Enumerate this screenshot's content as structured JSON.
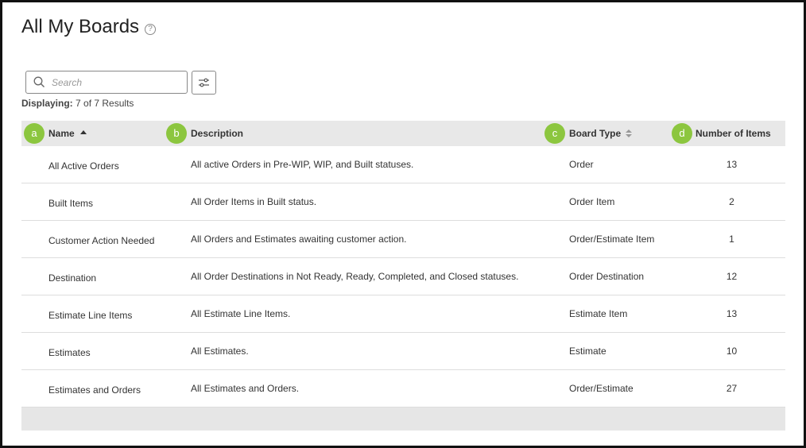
{
  "page": {
    "title": "All My Boards"
  },
  "search": {
    "placeholder": "Search"
  },
  "results": {
    "label": "Displaying:",
    "value": "7 of 7 Results"
  },
  "table": {
    "columns": [
      {
        "badge": "a",
        "label": "Name"
      },
      {
        "badge": "b",
        "label": "Description"
      },
      {
        "badge": "c",
        "label": "Board Type"
      },
      {
        "badge": "d",
        "label": "Number of Items"
      }
    ],
    "rows": [
      {
        "name": "All Active Orders",
        "description": "All active Orders in Pre-WIP, WIP, and Built statuses.",
        "type": "Order",
        "count": "13"
      },
      {
        "name": "Built Items",
        "description": "All Order Items in Built status.",
        "type": "Order Item",
        "count": "2"
      },
      {
        "name": "Customer Action Needed",
        "description": "All Orders and Estimates awaiting customer action.",
        "type": "Order/Estimate Item",
        "count": "1"
      },
      {
        "name": "Destination",
        "description": "All Order Destinations in Not Ready, Ready, Completed, and Closed statuses.",
        "type": "Order Destination",
        "count": "12"
      },
      {
        "name": "Estimate Line Items",
        "description": "All Estimate Line Items.",
        "type": "Estimate Item",
        "count": "13"
      },
      {
        "name": "Estimates",
        "description": "All Estimates.",
        "type": "Estimate",
        "count": "10"
      },
      {
        "name": "Estimates and Orders",
        "description": "All Estimates and Orders.",
        "type": "Order/Estimate",
        "count": "27"
      }
    ]
  },
  "colors": {
    "badge": "#8cc63f",
    "header_bg": "#e8e8e8"
  }
}
